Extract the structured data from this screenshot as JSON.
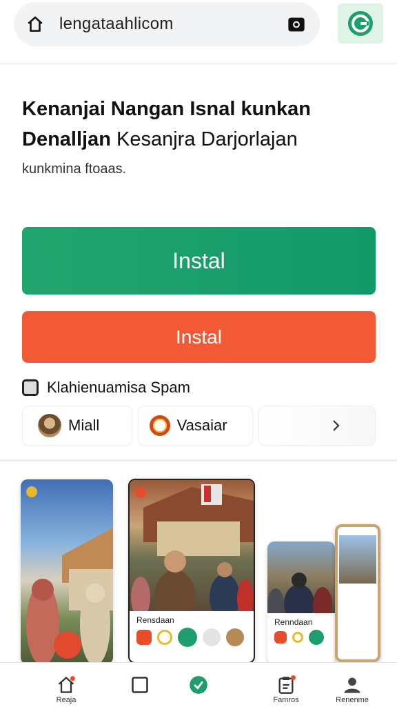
{
  "browser": {
    "url": "lengataahlicom",
    "home_icon": "home-icon",
    "camera_icon": "camera-icon",
    "extension_icon": "grammar-icon",
    "extension_color": "#1e9e6c"
  },
  "headline": {
    "line1": "Kenanjai Nangan Isnal kunkan",
    "line2_bold": "Denalljan",
    "line2_rest": " Kesanjra Darjorlajan",
    "subtitle": "kunkmina ftoaas."
  },
  "buttons": {
    "primary_label": "Instal",
    "primary_color": "#1e9e6c",
    "secondary_label": "Instal",
    "secondary_color": "#f25a36"
  },
  "spam": {
    "label": "Klahienuamisa Spam"
  },
  "chips": [
    {
      "label": "Miall"
    },
    {
      "label": "Vasaiar"
    },
    {
      "label": ""
    }
  ],
  "gallery": {
    "card2_label": "Rensdaan",
    "card3_label": "Renndaan"
  },
  "bottom_nav": [
    {
      "label": "Reaja",
      "icon": "home-icon"
    },
    {
      "label": "",
      "icon": "square-icon"
    },
    {
      "label": "",
      "icon": "check-icon"
    },
    {
      "label": "Famros",
      "icon": "clipboard-icon"
    },
    {
      "label": "Renenme",
      "icon": "user-icon"
    }
  ]
}
